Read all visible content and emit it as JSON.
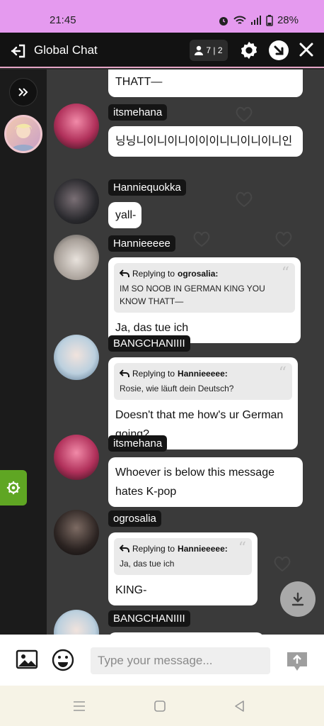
{
  "status": {
    "time": "21:45",
    "battery": "28%"
  },
  "header": {
    "title": "Global Chat",
    "online_count": "7 | 2"
  },
  "messages": [
    {
      "user": "",
      "text": "THATT—"
    },
    {
      "user": "itsmehana",
      "text": "닝닝니이니이니이이이니니이니이니인"
    },
    {
      "user": "Hanniequokka",
      "text": "yall-"
    },
    {
      "user": "Hannieeeee",
      "reply_label": "Replying to",
      "reply_to": "ogrosalia:",
      "reply_text": "IM SO NOOB IN GERMAN KING YOU KNOW THATT—",
      "text": "Ja, das tue ich"
    },
    {
      "user": "BANGCHANIIII",
      "reply_label": "Replying to",
      "reply_to": "Hannieeeee:",
      "reply_text": "Rosie, wie läuft dein Deutsch?",
      "text": "Doesn't that me how's ur German going?"
    },
    {
      "user": "itsmehana",
      "text": "Whoever is below this message hates K-pop"
    },
    {
      "user": "ogrosalia",
      "reply_label": "Replying to",
      "reply_to": "Hannieeeee:",
      "reply_text": "Ja, das tue ich",
      "text": "KING-"
    },
    {
      "user": "BANGCHANIIII",
      "text": ""
    }
  ],
  "composer": {
    "placeholder": "Type your message..."
  },
  "icons": {
    "back": "exit-icon",
    "users": "person-icon",
    "settings": "gear-icon",
    "minimize": "minimize-icon",
    "close": "close-icon",
    "expand": "double-chevron-icon",
    "image": "image-icon",
    "emoji": "emoji-icon",
    "send": "send-icon",
    "scroll": "scroll-down-icon"
  },
  "colors": {
    "status_bar": "#e59aef",
    "accent_green": "#5fa623",
    "header_bg": "#121212",
    "chat_bg": "#3a3a3a"
  }
}
